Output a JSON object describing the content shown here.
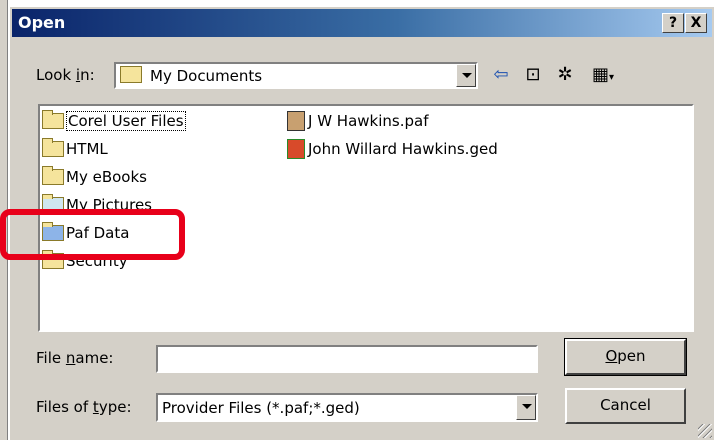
{
  "dialog": {
    "title": "Open",
    "help_btn": "?",
    "close_btn": "X"
  },
  "lookin": {
    "label_pre": "Look ",
    "label_acc": "i",
    "label_post": "n:",
    "value": "My Documents"
  },
  "toolbar": {
    "back_icon": "⇦",
    "up_icon": "⊡",
    "newfolder_icon": "✲",
    "views_icon": "▦"
  },
  "files": [
    {
      "name": "Corel User Files",
      "icon": "folder-icon"
    },
    {
      "name": "HTML",
      "icon": "folder-icon"
    },
    {
      "name": "My eBooks",
      "icon": "folder-icon"
    },
    {
      "name": "My Pictures",
      "icon": "pictures-folder-icon"
    },
    {
      "name": "Paf Data",
      "icon": "paf-folder-icon"
    },
    {
      "name": "Security",
      "icon": "folder-icon"
    },
    {
      "name": "J W Hawkins.paf",
      "icon": "paf-file-icon"
    },
    {
      "name": "John Willard Hawkins.ged",
      "icon": "ged-file-icon"
    }
  ],
  "filename": {
    "label_pre": "File ",
    "label_acc": "n",
    "label_post": "ame:",
    "value": ""
  },
  "filetype": {
    "label_pre": "Files of ",
    "label_acc": "t",
    "label_post": "ype:",
    "value": "Provider Files (*.paf;*.ged)"
  },
  "buttons": {
    "open_acc": "O",
    "open_rest": "pen",
    "cancel": "Cancel"
  },
  "colors": {
    "highlight": "#e8001a",
    "titlebar": "#0a246a"
  }
}
